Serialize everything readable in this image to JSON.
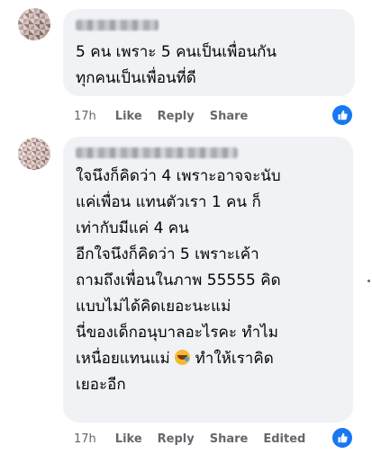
{
  "comments": [
    {
      "text": "5 คน เพราะ 5 คนเป็นเพื่อนกัน\nทุกคนเป็นเพื่อนที่ดี",
      "time": "17h",
      "like_label": "Like",
      "reply_label": "Reply",
      "share_label": "Share"
    },
    {
      "text_part1": "ใจนึงก็คิดว่า 4 เพราะอาจจะนับ\nแค่เพื่อน แทนตัวเรา 1 คน ก็\nเท่ากับมีแค่ 4 คน\nอีกใจนึงก็คิดว่า 5 เพราะเค้า\nถามถึงเพื่อนในภาพ 55555 คิด\nแบบไม่ได้คิดเยอะนะแม่\nนี่ของเด็กอนุบาลอะไรคะ ทำไม\nเหนื่อยแทนแม่ ",
      "emoji": "rofl-emoji-icon",
      "text_part2": " ทำให้เราคิด\nเยอะอีก",
      "time": "17h",
      "like_label": "Like",
      "reply_label": "Reply",
      "share_label": "Share",
      "edited_label": "Edited"
    }
  ],
  "colors": {
    "bubble": "#f0f2f5",
    "meta": "#65676b",
    "like_blue": "#1877f2"
  }
}
